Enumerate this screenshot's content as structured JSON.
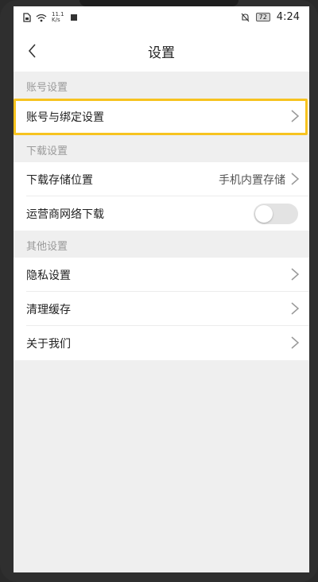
{
  "status_bar": {
    "net_speed_value": "11.1",
    "net_speed_unit": "K/s",
    "battery": "72",
    "time": "4:24"
  },
  "header": {
    "title": "设置"
  },
  "sections": {
    "account": {
      "header": "账号设置",
      "items": [
        {
          "label": "账号与绑定设置"
        }
      ]
    },
    "download": {
      "header": "下载设置",
      "items": [
        {
          "label": "下载存储位置",
          "value": "手机内置存储"
        },
        {
          "label": "运营商网络下载",
          "toggle": false
        }
      ]
    },
    "other": {
      "header": "其他设置",
      "items": [
        {
          "label": "隐私设置"
        },
        {
          "label": "清理缓存"
        },
        {
          "label": "关于我们"
        }
      ]
    }
  },
  "colors": {
    "highlight": "#f7c31f",
    "background": "#efefef",
    "section_text": "#9a9a9a"
  }
}
